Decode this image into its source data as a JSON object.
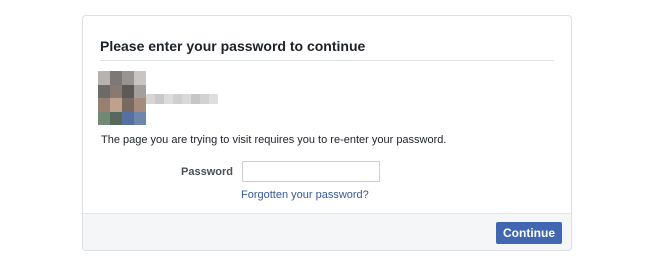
{
  "dialog": {
    "title": "Please enter your password to continue",
    "message": "The page you are trying to visit requires you to re-enter your password.",
    "password_label": "Password",
    "password_value": "",
    "password_placeholder": "",
    "forgot_link": "Forgotten your password?",
    "continue_label": "Continue"
  },
  "icons": {
    "avatar": "blurred-profile-photo",
    "name": "blurred-user-name"
  },
  "colors": {
    "accent": "#4267b2",
    "link": "#385898",
    "text": "#1d2129",
    "label": "#4b4f56",
    "footer_bg": "#f5f6f7",
    "border": "#dddfe2"
  }
}
